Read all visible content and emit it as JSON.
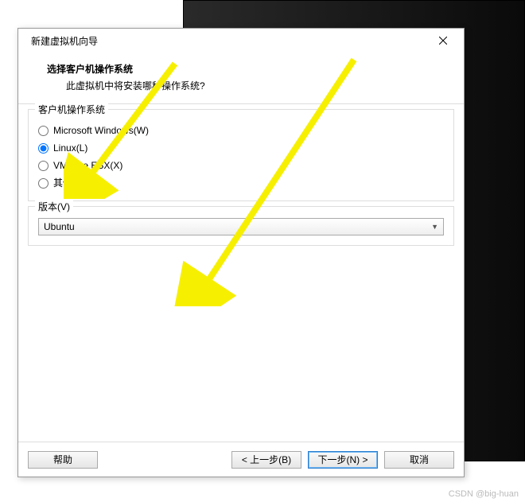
{
  "dialog": {
    "title": "新建虚拟机向导",
    "close_tooltip": "关闭"
  },
  "header": {
    "title": "选择客户机操作系统",
    "subtitle": "此虚拟机中将安装哪种操作系统?"
  },
  "os_group": {
    "legend": "客户机操作系统",
    "options": [
      {
        "label": "Microsoft Windows(W)",
        "selected": false
      },
      {
        "label": "Linux(L)",
        "selected": true
      },
      {
        "label": "VMware ESX(X)",
        "selected": false
      },
      {
        "label": "其他(O)",
        "selected": false
      }
    ]
  },
  "version_group": {
    "legend": "版本(V)",
    "selected": "Ubuntu"
  },
  "footer": {
    "help": "帮助",
    "back": "< 上一步(B)",
    "next": "下一步(N) >",
    "cancel": "取消"
  },
  "watermark": "CSDN @big-huan"
}
